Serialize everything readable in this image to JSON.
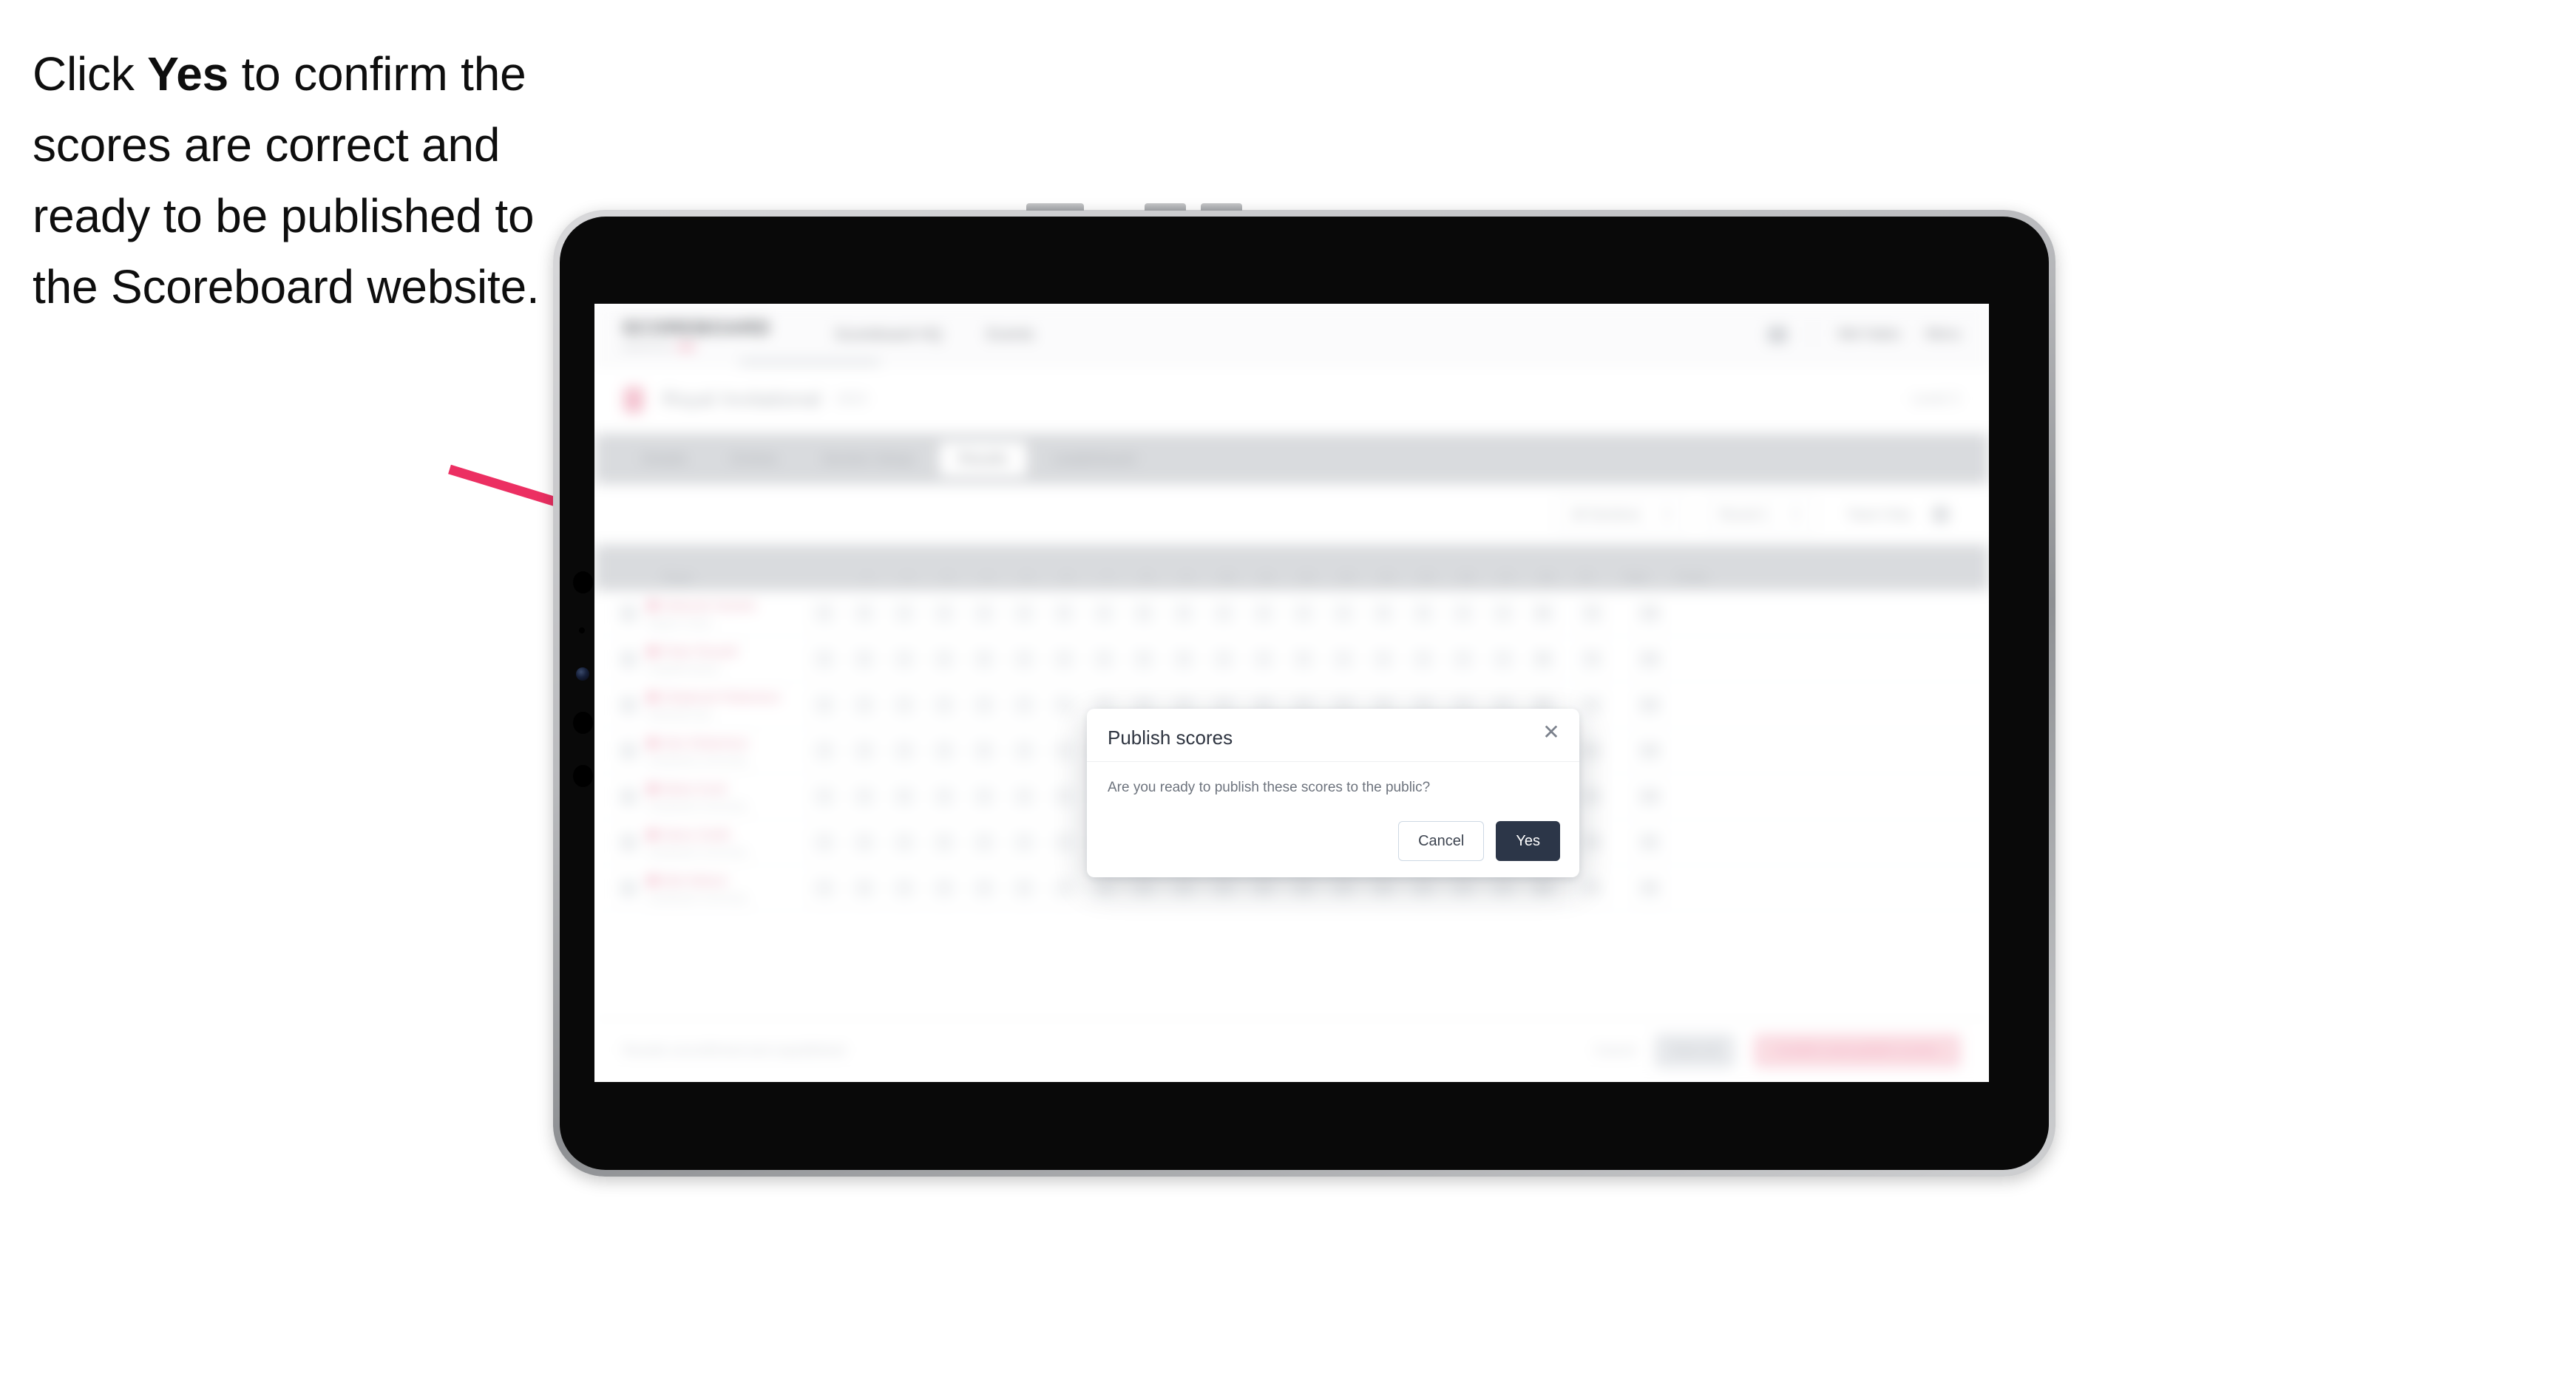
{
  "caption": {
    "before": "Click ",
    "emphasis": "Yes",
    "after": " to confirm the scores are correct and ready to be published to the Scoreboard website."
  },
  "arrow": {
    "color": "#ec2f62"
  },
  "device": {
    "type": "tablet",
    "bezel_color": "#090909",
    "frame_color": "#b9babd"
  },
  "app": {
    "header": {
      "logo": "SCOREBOARD",
      "logo_sub": "powered by",
      "nav": [
        {
          "label": "Scoreboard HQ"
        },
        {
          "label": "Events"
        }
      ],
      "nav_right": [
        {
          "label": "Mel Hales"
        },
        {
          "label": "Menu"
        }
      ],
      "icon": "grid-icon"
    },
    "event": {
      "flag_icon": "flag-icon",
      "name": "Royal Invitational",
      "sub": "2023",
      "right": "Level 3"
    },
    "tabs": [
      {
        "label": "Details"
      },
      {
        "label": "Entries"
      },
      {
        "label": "Section Setup"
      },
      {
        "label": "Results"
      },
      {
        "label": "Leaderboard"
      }
    ],
    "active_tab": "Results",
    "toolbar": {
      "filters": [
        {
          "label": "All Sections"
        },
        {
          "label": "Round 1"
        },
        {
          "label": "Team Only"
        }
      ],
      "icon": "settings-icon"
    },
    "table": {
      "columns": [
        "Player",
        "1",
        "2",
        "3",
        "4",
        "5",
        "6",
        "7",
        "8",
        "9",
        "10",
        "11",
        "12",
        "13",
        "14",
        "15",
        "16",
        "17",
        "18",
        "Pl",
        "Total",
        "Points"
      ],
      "rows": [
        {
          "name": "Deborah Daniels",
          "club": "Regent Cricket",
          "scores": [
            "6",
            "5",
            "4",
            "4",
            "4",
            "4",
            "5",
            "4",
            "6",
            "5",
            "4",
            "4",
            "4",
            "4",
            "5",
            "5",
            "4",
            "4"
          ],
          "pl": "36",
          "total": "76",
          "points": "105"
        },
        {
          "name": "Peter Russell",
          "club": "Kingsfield Sports",
          "scores": [
            "5",
            "5",
            "4",
            "4",
            "5",
            "4",
            "4",
            "4",
            "5",
            "5",
            "4",
            "4",
            "5",
            "4",
            "4",
            "4",
            "4",
            "4"
          ],
          "pl": "36",
          "total": "74",
          "points": "104"
        },
        {
          "name": "Shalarosh Robertson",
          "club": "Rotherhill Club",
          "scores": [
            "5",
            "4",
            "4",
            "4",
            "4",
            "4",
            "5",
            "4",
            "5",
            "4",
            "4",
            "5",
            "4",
            "4",
            "4",
            "4",
            "4",
            "5"
          ],
          "pl": "36",
          "total": "73",
          "points": "102"
        },
        {
          "name": "Alex Robertson",
          "club": "Southlands Community",
          "scores": [
            "4",
            "4",
            "4",
            "4",
            "5",
            "4",
            "4",
            "4",
            "4",
            "5",
            "4",
            "4",
            "4",
            "5",
            "4",
            "4",
            "5",
            "4"
          ],
          "pl": "36",
          "total": "81",
          "points": "100"
        },
        {
          "name": "Maria Scott",
          "club": "Southlands Community",
          "scores": [
            "4",
            "4",
            "5",
            "4",
            "4",
            "4",
            "5",
            "4",
            "4",
            "4",
            "4",
            "4",
            "5",
            "4",
            "4",
            "5",
            "4",
            "4"
          ],
          "pl": "34",
          "total": "82",
          "points": "100"
        },
        {
          "name": "Steve Smith",
          "club": "Southlands Community",
          "scores": [
            "4",
            "4",
            "4",
            "5",
            "4",
            "4",
            "4",
            "5",
            "4",
            "4",
            "5",
            "4",
            "4",
            "4",
            "4",
            "4",
            "4",
            "5"
          ],
          "pl": "36",
          "total": "78",
          "points": "98"
        },
        {
          "name": "Bob Nelson",
          "club": "Southlands Community",
          "scores": [
            "4",
            "5",
            "4",
            "4",
            "4",
            "5",
            "4",
            "4",
            "4",
            "4",
            "4",
            "5",
            "4",
            "4",
            "5",
            "4",
            "4",
            "4"
          ],
          "pl": "36",
          "total": "76",
          "points": "98"
        }
      ]
    },
    "footer": {
      "note": "Results unconfirmed and unpublished",
      "link": "Cancel",
      "secondary_button": "Save all",
      "primary_button": "Confirm and publish scores"
    }
  },
  "modal": {
    "title": "Publish scores",
    "close_icon": "close-icon",
    "body": "Are you ready to publish these scores to the public?",
    "cancel_label": "Cancel",
    "confirm_label": "Yes",
    "confirm_color": "#2c3648"
  }
}
